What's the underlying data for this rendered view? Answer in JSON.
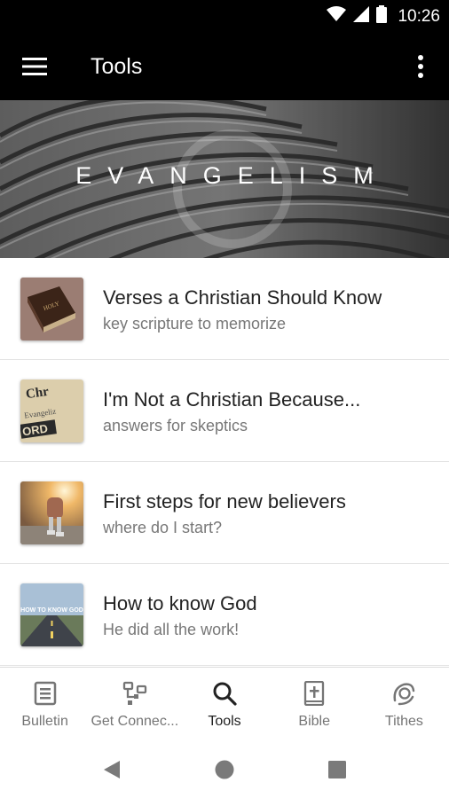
{
  "status_bar": {
    "time": "10:26"
  },
  "app_bar": {
    "title": "Tools"
  },
  "hero": {
    "title": "EVANGELISM"
  },
  "items": [
    {
      "title": "Verses a Christian Should Know",
      "subtitle": "key scripture to memorize",
      "thumb_icon": "bible-book-image",
      "thumb_text": ""
    },
    {
      "title": "I'm Not a Christian Because...",
      "subtitle": "answers for skeptics",
      "thumb_icon": "newspaper-words-image",
      "thumb_text": "Chr Evangeliz ORD"
    },
    {
      "title": "First steps for new believers",
      "subtitle": "where do I start?",
      "thumb_icon": "child-walking-image",
      "thumb_text": ""
    },
    {
      "title": "How to know God",
      "subtitle": "He did all the work!",
      "thumb_icon": "road-image",
      "thumb_text": "HOW TO KNOW GOD"
    }
  ],
  "bottom_nav": [
    {
      "label": "Bulletin",
      "icon": "bulletin-icon",
      "active": false
    },
    {
      "label": "Get Connec...",
      "icon": "connect-icon",
      "active": false
    },
    {
      "label": "Tools",
      "icon": "search-icon",
      "active": true
    },
    {
      "label": "Bible",
      "icon": "bible-icon",
      "active": false
    },
    {
      "label": "Tithes",
      "icon": "tithes-icon",
      "active": false
    }
  ],
  "colors": {
    "app_bar": "#000000",
    "text_primary": "#222222",
    "text_secondary": "#777777",
    "nav_inactive": "#757575"
  }
}
